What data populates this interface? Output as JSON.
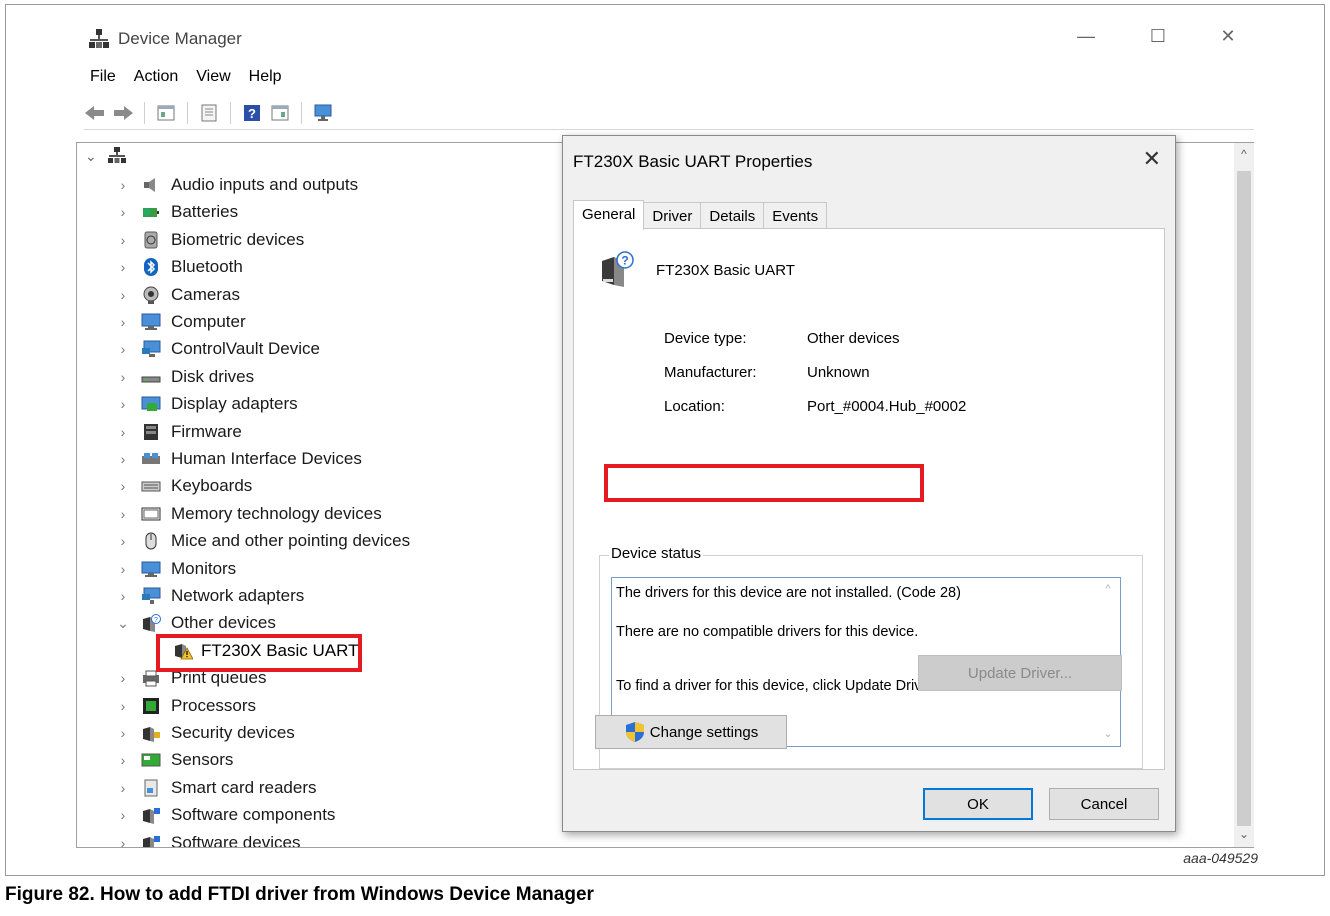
{
  "window": {
    "title": "Device Manager",
    "controls": {
      "minimize": "—",
      "maximize": "☐",
      "close": "✕"
    }
  },
  "menu": [
    "File",
    "Action",
    "View",
    "Help"
  ],
  "toolbar_icons": [
    "back-arrow-icon",
    "forward-arrow-icon",
    "properties-icon",
    "document-icon",
    "help-icon",
    "show-hidden-icon",
    "monitor-icon"
  ],
  "tree": {
    "categories": [
      {
        "label": "Audio inputs and outputs",
        "icon": "speaker-icon"
      },
      {
        "label": "Batteries",
        "icon": "battery-icon"
      },
      {
        "label": "Biometric devices",
        "icon": "fingerprint-icon"
      },
      {
        "label": "Bluetooth",
        "icon": "bluetooth-icon"
      },
      {
        "label": "Cameras",
        "icon": "camera-icon"
      },
      {
        "label": "Computer",
        "icon": "computer-icon"
      },
      {
        "label": "ControlVault Device",
        "icon": "controlvault-icon"
      },
      {
        "label": "Disk drives",
        "icon": "disk-icon"
      },
      {
        "label": "Display adapters",
        "icon": "display-icon"
      },
      {
        "label": "Firmware",
        "icon": "firmware-icon"
      },
      {
        "label": "Human Interface Devices",
        "icon": "hid-icon"
      },
      {
        "label": "Keyboards",
        "icon": "keyboard-icon"
      },
      {
        "label": "Memory technology devices",
        "icon": "memory-icon"
      },
      {
        "label": "Mice and other pointing devices",
        "icon": "mouse-icon"
      },
      {
        "label": "Monitors",
        "icon": "monitor-icon"
      },
      {
        "label": "Network adapters",
        "icon": "network-icon"
      },
      {
        "label": "Other devices",
        "icon": "unknown-device-icon"
      },
      {
        "label": "Print queues",
        "icon": "printer-icon"
      },
      {
        "label": "Processors",
        "icon": "processor-icon"
      },
      {
        "label": "Security devices",
        "icon": "security-icon"
      },
      {
        "label": "Sensors",
        "icon": "sensor-icon"
      },
      {
        "label": "Smart card readers",
        "icon": "smartcard-icon"
      },
      {
        "label": "Software components",
        "icon": "software-icon"
      },
      {
        "label": "Software devices",
        "icon": "software-icon"
      }
    ],
    "child": "FT230X Basic UART"
  },
  "dialog": {
    "title": "FT230X Basic UART Properties",
    "tabs": [
      "General",
      "Driver",
      "Details",
      "Events"
    ],
    "device_name": "FT230X Basic UART",
    "props": {
      "type_label": "Device type:",
      "type_value": "Other devices",
      "mfr_label": "Manufacturer:",
      "mfr_value": "Unknown",
      "loc_label": "Location:",
      "loc_value": "Port_#0004.Hub_#0002"
    },
    "status_legend": "Device status",
    "status_line1": "The drivers for this device are not installed.",
    "status_line1_code": " (Code 28)",
    "status_line2": "There are no compatible drivers for this device.",
    "status_line3": "To find a driver for this device, click Update Driver.",
    "update_button": "Update Driver...",
    "change_button": "Change settings",
    "ok_button": "OK",
    "cancel_button": "Cancel"
  },
  "figure_id": "aaa-049529",
  "caption": "Figure 82.  How to add FTDI driver from Windows Device Manager",
  "colors": {
    "highlight": "#e41b23",
    "accent": "#0078d7"
  }
}
